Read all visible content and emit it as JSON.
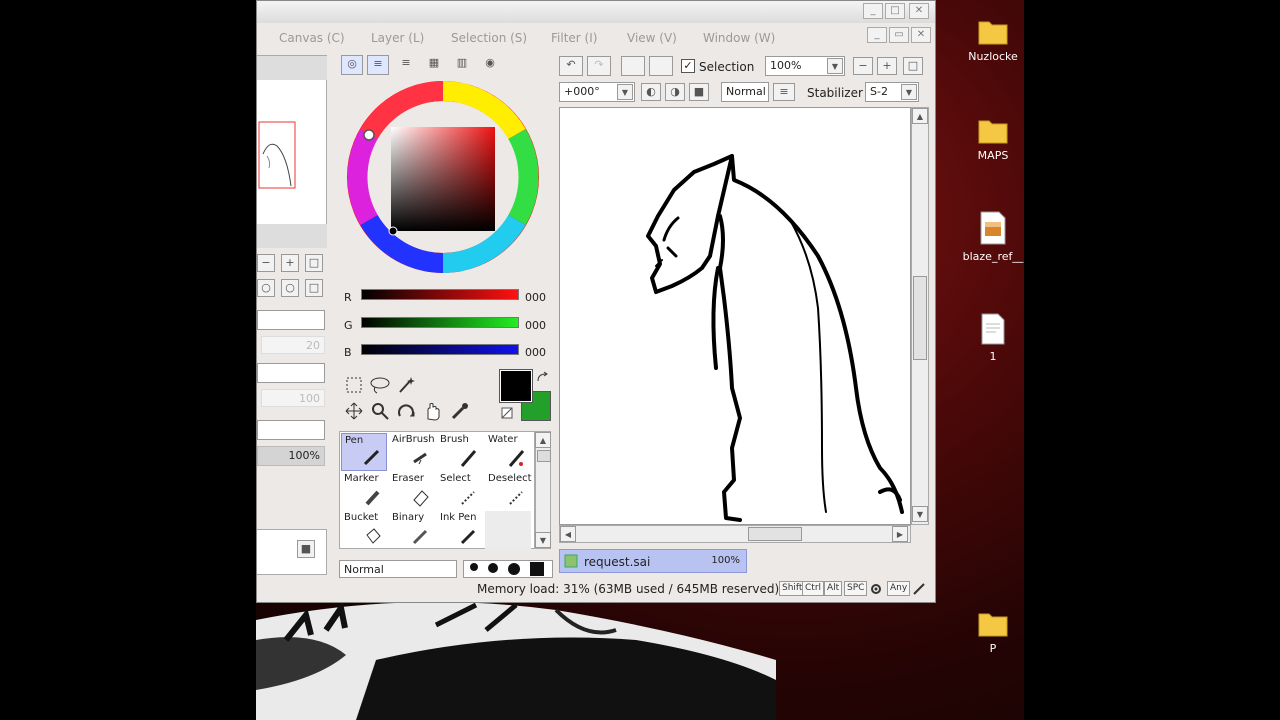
{
  "menu": [
    "Canvas (C)",
    "Layer (L)",
    "Selection (S)",
    "Filter (I)",
    "View (V)",
    "Window (W)"
  ],
  "rgb": {
    "r_label": "R",
    "r_value": "000",
    "g_label": "G",
    "g_value": "000",
    "b_label": "B",
    "b_value": "000"
  },
  "left_panel": {
    "field_a": "20",
    "field_b": "100",
    "percent": "100%"
  },
  "tools": [
    {
      "label": "Pen"
    },
    {
      "label": "AirBrush"
    },
    {
      "label": "Brush"
    },
    {
      "label": "Water"
    },
    {
      "label": "Marker"
    },
    {
      "label": "Eraser"
    },
    {
      "label": "Select"
    },
    {
      "label": "Deselect"
    },
    {
      "label": "Bucket"
    },
    {
      "label": "Binary"
    },
    {
      "label": "Ink Pen"
    }
  ],
  "blend_mode_bottom": "Normal",
  "toolbar": {
    "selection_label": "Selection",
    "zoom_value": "100%",
    "angle_value": "+000°",
    "blend_mode": "Normal",
    "stabilizer_label": "Stabilizer",
    "stabilizer_value": "S-2"
  },
  "document_tab": {
    "name": "request.sai",
    "zoom": "100%"
  },
  "status": {
    "memory": "Memory load: 31% (63MB used / 645MB reserved)",
    "keys": [
      "Shift",
      "Ctrl",
      "Alt",
      "SPC",
      "Any"
    ]
  },
  "desktop_icons": [
    {
      "label": "Nuzlocke",
      "icon": "folder-icon"
    },
    {
      "label": "MAPS",
      "icon": "folder-icon"
    },
    {
      "label": "blaze_ref__",
      "icon": "image-file-icon"
    },
    {
      "label": "1",
      "icon": "document-icon"
    },
    {
      "label": "P",
      "icon": "folder-icon"
    }
  ],
  "colors": {
    "primary": "#000000",
    "secondary": "#22a02a",
    "doc_tab_bg": "#b9c3f2",
    "desktop_bg": "#5a0a0a"
  }
}
